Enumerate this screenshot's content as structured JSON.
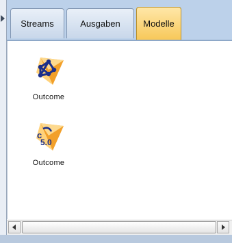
{
  "tabs": [
    {
      "label": "Streams",
      "active": false
    },
    {
      "label": "Ausgaben",
      "active": false
    },
    {
      "label": "Modelle",
      "active": true
    }
  ],
  "models": [
    {
      "label": "Outcome",
      "icon": "neural-net-model-icon"
    },
    {
      "label": "Outcome",
      "icon": "c5-tree-model-icon",
      "badge": "5.0"
    }
  ],
  "colors": {
    "accent": "#f7c85a",
    "model_gem": "#f2a02a",
    "tabbar": "#bcd1ea"
  }
}
